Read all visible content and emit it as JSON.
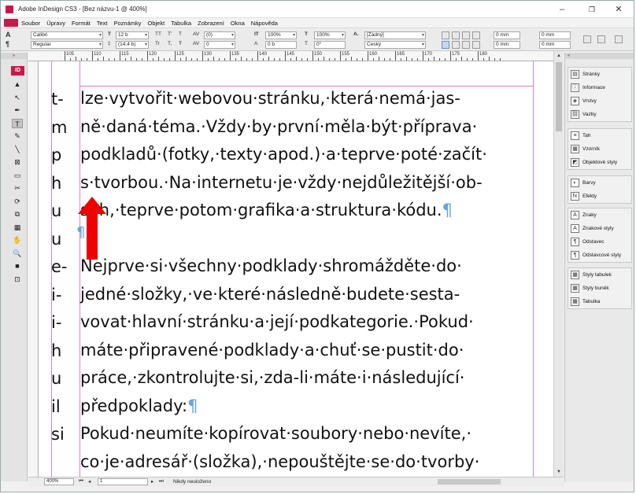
{
  "window": {
    "title": "Adobe InDesign CS3 - [Bez názvu-1 @ 400%]",
    "min_glyph": "–",
    "max_glyph": "❐",
    "close_glyph": "✕"
  },
  "menu": {
    "logo": "",
    "items": [
      "Soubor",
      "Úpravy",
      "Formát",
      "Text",
      "Poznámky",
      "Objekt",
      "Tabulka",
      "Zobrazení",
      "Okna",
      "Nápověda"
    ]
  },
  "control": {
    "char_glyph": "A",
    "para_glyph": "¶",
    "font": "Calibri",
    "style": "Regular",
    "size": "12 b",
    "leading": "(14,4 b)",
    "tracking": "(0)",
    "kerning": "0",
    "hscale": "100%",
    "vscale": "100%",
    "baseline": "0 b",
    "skew": "0°",
    "charstyle": "[Žádný]",
    "language": "Český",
    "indent1": "0 mm",
    "indent2": "0 mm",
    "indent3": "0 mm",
    "indent4": "0 mm",
    "indent5": "0 mm",
    "indent6": "0 mm",
    "caps1": "TT",
    "caps2": "T'",
    "caps3": "T",
    "caps4": "Tr",
    "caps5": "T,",
    "caps6": "Ŧ"
  },
  "ruler": {
    "numbers": [
      "105",
      "110",
      "115",
      "120",
      "125",
      "130",
      "135",
      "140",
      "145",
      "150",
      "155",
      "160",
      "165",
      "170",
      "175",
      "180"
    ]
  },
  "tools": {
    "logo": "ID",
    "grip": "»",
    "items": [
      "▲",
      "↖",
      "✒",
      "T",
      "✎",
      "╲",
      "⊠",
      "▭",
      "✂",
      "⟳",
      "⧉",
      "▦",
      "✋",
      "🔍",
      "■",
      "⊡"
    ]
  },
  "document": {
    "col_pieces": [
      "t-",
      "m",
      "p",
      "h",
      "u",
      "u",
      "e-",
      "i-",
      "i-",
      "h",
      "u",
      "il",
      "si"
    ],
    "lines": [
      "lze·vytvořit·webovou·stránku,·která·nemá·jas-",
      "ně·daná·téma.·Vždy·by·první·měla·být·příprava·",
      "podkladů·(fotky,·texty·apod.)·a·teprve·poté·začít·",
      "s·tvorbou.·Na·internetu·je·vždy·nejdůležitější·ob-",
      "sah,·teprve·potom·grafika·a·struktura·kódu."
    ],
    "lines2": [
      "Nejprve·si·všechny·podklady·shromážděte·do·",
      "jedné·složky,·ve·které·následně·budete·sesta-",
      "vovat·hlavní·stránku·a·její·podkategorie.·Pokud·",
      "máte·připravené·podklady·a·chuť·se·pustit·do·",
      "práce,·zkontrolujte·si,·zda-li·máte·i·následující·",
      "předpoklady:"
    ],
    "lines3": [
      "Pokud·neumíte·kopírovat·soubory·nebo·nevíte,·",
      "co·je·adresář·(složka),·nepouštějte·se·do·tvorby·"
    ],
    "pilcrow": "¶"
  },
  "status": {
    "zoom": "400%",
    "page": "1",
    "state": "Nikdy neuloženo"
  },
  "panels": {
    "grip": "«",
    "group1": [
      {
        "icon": "▤",
        "label": "Stránky"
      },
      {
        "icon": "ⓘ",
        "label": "Informace"
      },
      {
        "icon": "◈",
        "label": "Vrstvy"
      },
      {
        "icon": "⛓",
        "label": "Vazby"
      }
    ],
    "group2": [
      {
        "icon": "≡",
        "label": "Tah"
      },
      {
        "icon": "▦",
        "label": "Vzorník"
      },
      {
        "icon": "◩",
        "label": "Objektové styly"
      }
    ],
    "group3": [
      {
        "icon": "◐",
        "label": "Barvy"
      },
      {
        "icon": "fx",
        "label": "Efekty"
      }
    ],
    "group4": [
      {
        "icon": "A",
        "label": "Znaky"
      },
      {
        "icon": "A",
        "label": "Znakové styly"
      },
      {
        "icon": "¶",
        "label": "Odstavec"
      },
      {
        "icon": "¶",
        "label": "Odstavcové styly"
      }
    ],
    "group5": [
      {
        "icon": "▦",
        "label": "Styly tabulek"
      },
      {
        "icon": "▦",
        "label": "Styly buněk"
      },
      {
        "icon": "▦",
        "label": "Tabulka"
      }
    ]
  }
}
